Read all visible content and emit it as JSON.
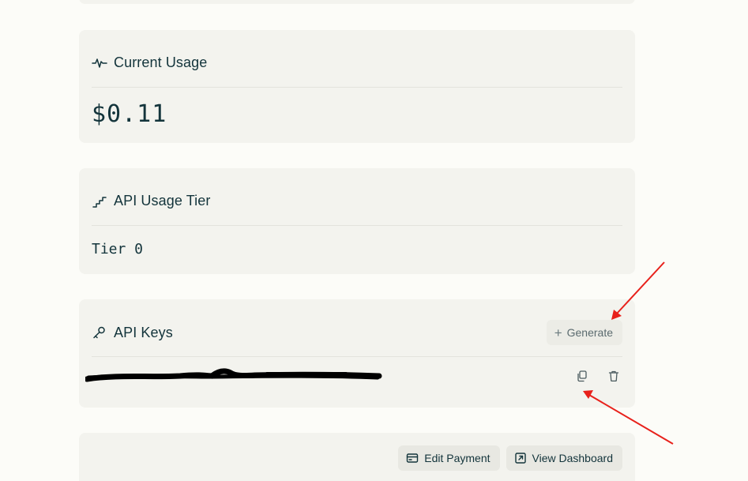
{
  "usage": {
    "title": "Current Usage",
    "value": "$0.11"
  },
  "tier": {
    "title": "API Usage Tier",
    "value": "Tier 0"
  },
  "api_keys": {
    "title": "API Keys",
    "generate_label": "Generate",
    "key_value_redacted": true
  },
  "actions": {
    "edit_payment_label": "Edit Payment",
    "view_dashboard_label": "View Dashboard"
  },
  "icons": {
    "usage": "activity-icon",
    "tier": "stairs-icon",
    "keys": "key-icon",
    "generate": "plus-icon",
    "copy": "copy-icon",
    "delete": "trash-icon",
    "payment": "credit-card-icon",
    "dashboard": "external-link-icon"
  },
  "colors": {
    "background": "#fcfcf8",
    "card": "#f3f3ee",
    "text": "#13343b",
    "annotation_arrow": "#e8211b"
  }
}
